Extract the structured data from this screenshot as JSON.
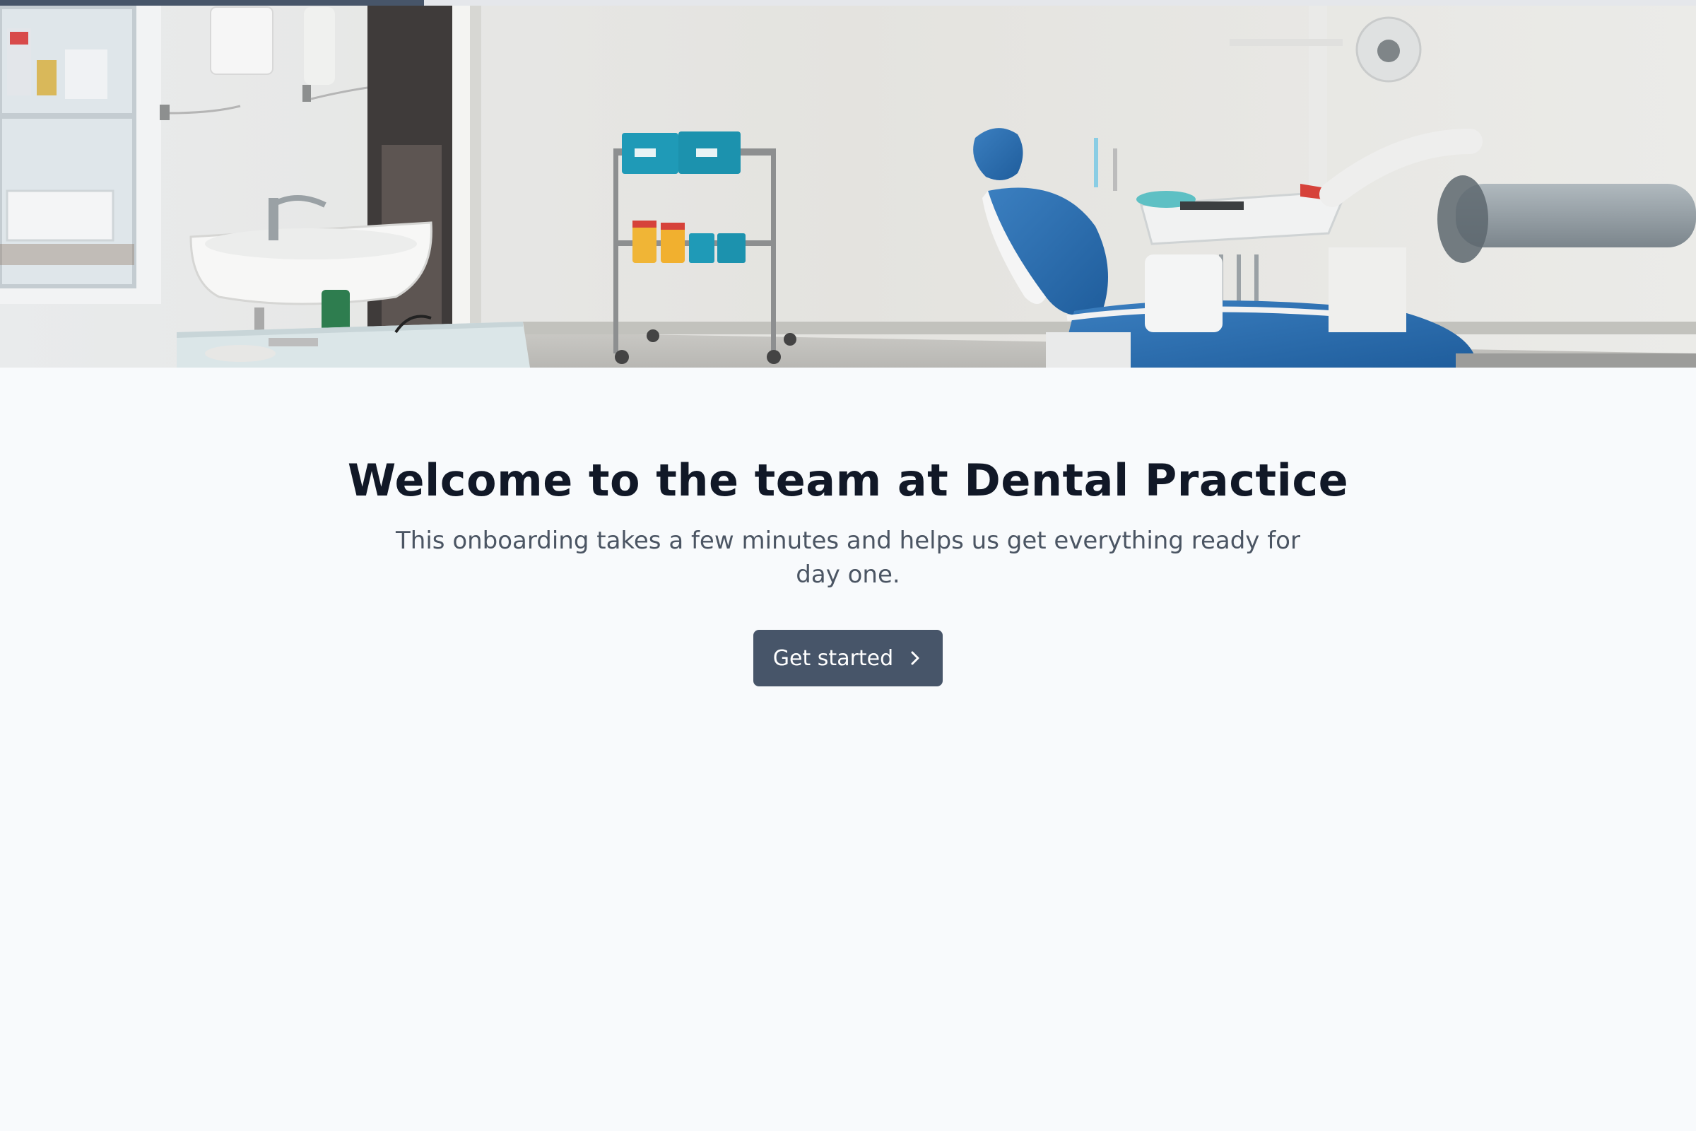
{
  "progress": {
    "fraction": 0.25
  },
  "hero": {
    "image_description": "dental-treatment-room-photo"
  },
  "welcome": {
    "title": "Welcome to the team at Dental Practice",
    "subtitle": "This onboarding takes a few minutes and helps us get everything ready for day one."
  },
  "actions": {
    "get_started_label": "Get started",
    "get_started_icon": "chevron-right-icon"
  },
  "colors": {
    "background": "#f8fafc",
    "accent": "#475569",
    "progress_track": "#e5e7eb",
    "title": "#111827",
    "subtitle": "#4b5563"
  }
}
